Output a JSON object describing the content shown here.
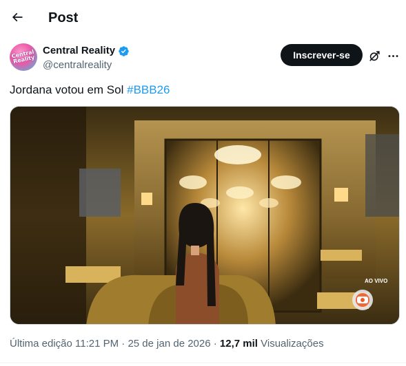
{
  "header": {
    "back_icon": "arrow-left-icon",
    "title": "Post"
  },
  "author": {
    "avatar_text": "Central Reality",
    "name": "Central Reality",
    "verified_icon": "verified-badge-icon",
    "handle": "@centralreality"
  },
  "actions": {
    "subscribe_label": "Inscrever-se",
    "grok_icon": "grok-icon",
    "more_icon": "more-horizontal-icon"
  },
  "tweet": {
    "text": "Jordana votou em Sol",
    "hashtag": "#BBB26"
  },
  "media": {
    "overlay_label": "AO VIVO",
    "broadcaster_logo": "globo-logo"
  },
  "meta": {
    "edited": "Última edição 11:21 PM · 25 de jan de 2026",
    "separator": " · ",
    "views_count": "12,7 mil",
    "views_label": "Visualizações"
  },
  "colors": {
    "accent": "#1d9bf0",
    "text": "#0f1419",
    "secondary": "#536471",
    "button_bg": "#0f1419"
  }
}
